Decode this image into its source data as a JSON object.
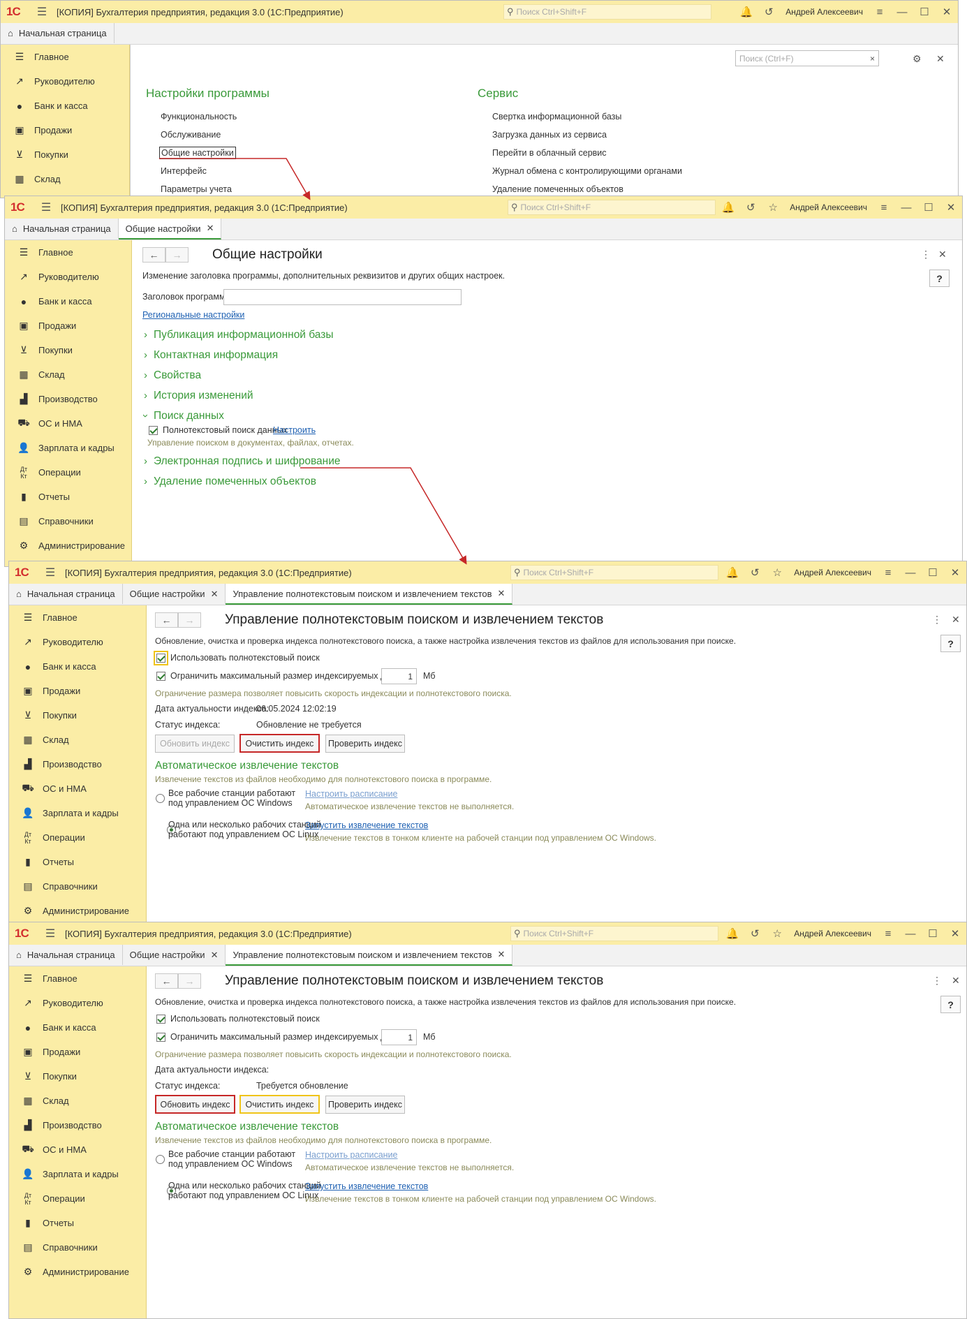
{
  "app": {
    "logo": "1С",
    "title": "[КОПИЯ] Бухгалтерия предприятия, редакция 3.0  (1С:Предприятие)",
    "search_placeholder": "Поиск Ctrl+Shift+F",
    "user": "Андрей Алексеевич"
  },
  "tabs": {
    "home": "Начальная страница",
    "general": "Общие настройки",
    "fts": "Управление полнотекстовым поиском и извлечением текстов"
  },
  "sidebar": [
    {
      "label": "Главное",
      "icon": "menu-icon"
    },
    {
      "label": "Руководителю",
      "icon": "trend-icon"
    },
    {
      "label": "Банк и касса",
      "icon": "coin-icon"
    },
    {
      "label": "Продажи",
      "icon": "bag-icon"
    },
    {
      "label": "Покупки",
      "icon": "cart-icon"
    },
    {
      "label": "Склад",
      "icon": "grid-icon"
    },
    {
      "label": "Производство",
      "icon": "factory-icon"
    },
    {
      "label": "ОС и НМА",
      "icon": "truck-icon"
    },
    {
      "label": "Зарплата и кадры",
      "icon": "person-icon"
    },
    {
      "label": "Операции",
      "icon": "dtkt-icon"
    },
    {
      "label": "Отчеты",
      "icon": "bars-icon"
    },
    {
      "label": "Справочники",
      "icon": "book-icon"
    },
    {
      "label": "Администрирование",
      "icon": "gear-icon"
    }
  ],
  "window1": {
    "search_placeholder": "Поиск (Ctrl+F)",
    "col1_title": "Настройки программы",
    "col1_items": [
      "Функциональность",
      "Обслуживание",
      "Общие настройки",
      "Интерфейс",
      "Параметры учета"
    ],
    "col2_title": "Сервис",
    "col2_items": [
      "Свертка информационной базы",
      "Загрузка данных из сервиса",
      "Перейти в облачный сервис",
      "Журнал обмена с контролирующими органами",
      "Удаление помеченных объектов"
    ]
  },
  "window2": {
    "form_title": "Общие настройки",
    "description": "Изменение заголовка программы, дополнительных реквизитов и других общих настроек.",
    "field_label": "Заголовок программы:",
    "field_value": "",
    "regional_link": "Региональные настройки",
    "sections": [
      "Публикация информационной базы",
      "Контактная информация",
      "Свойства",
      "История изменений"
    ],
    "search_section": "Поиск данных",
    "fts_checkbox": "Полнотекстовый поиск данных",
    "fts_link": "Настроить",
    "fts_hint": "Управление поиском в документах, файлах, отчетах.",
    "sections_after": [
      "Электронная подпись и шифрование",
      "Удаление помеченных объектов"
    ]
  },
  "fts_form": {
    "title": "Управление полнотекстовым поиском и извлечением текстов",
    "description": "Обновление, очистка и проверка индекса полнотекстового поиска, а также настройка извлечения текстов из файлов для использования при поиске.",
    "use_fts": "Использовать полнотекстовый поиск",
    "limit_size": "Ограничить максимальный размер индексируемых данных",
    "limit_value": "1",
    "limit_unit": "Мб",
    "limit_hint": "Ограничение размера позволяет повысить скорость индексации и полнотекстового поиска.",
    "date_label": "Дата актуальности индекса:",
    "status_label": "Статус индекса:",
    "btn_update": "Обновить индекс",
    "btn_clear": "Очистить индекс",
    "btn_check": "Проверить индекс",
    "auto_title": "Автоматическое извлечение текстов",
    "auto_hint": "Извлечение текстов из файлов необходимо для полнотекстового поиска в программе.",
    "radio1_line1": "Все рабочие станции работают",
    "radio1_line2": "под управлением ОС Windows",
    "radio1_link": "Настроить расписание",
    "radio1_hint": "Автоматическое извлечение текстов не выполняется.",
    "radio2_line1": "Одна или несколько рабочих станций",
    "radio2_line2": "работают под управлением ОС Linux",
    "radio2_link": "Запустить извлечение текстов",
    "radio2_hint": "Извлечение текстов в тонком клиенте на рабочей станции под управлением ОС Windows."
  },
  "window3": {
    "date_value": "06.05.2024 12:02:19",
    "status_value": "Обновление не требуется"
  },
  "window4": {
    "date_value": "",
    "status_value": "Требуется обновление"
  },
  "colors": {
    "titlebar": "#fbeda6",
    "accent_green": "#3a9a3a",
    "highlight_red": "#c62828",
    "focus_yellow": "#f0c419"
  }
}
